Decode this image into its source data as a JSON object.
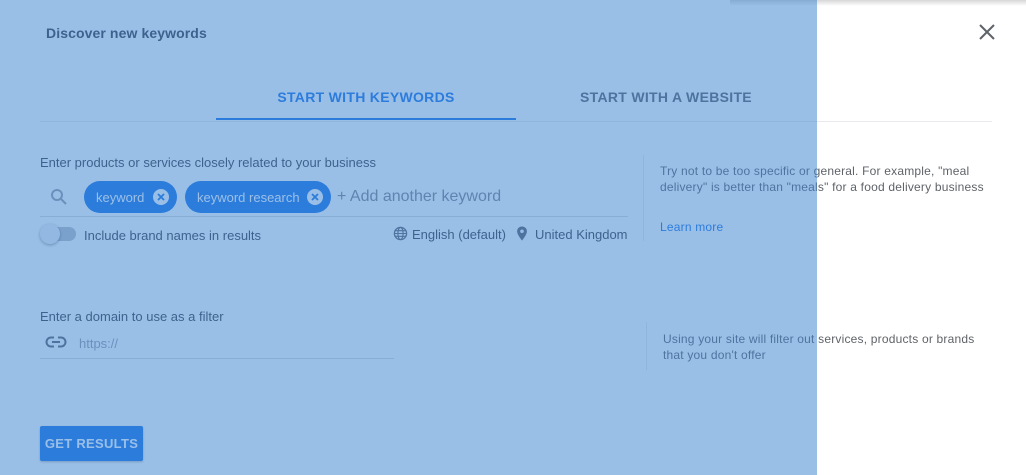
{
  "dialog": {
    "title": "Discover new keywords",
    "close_icon": "close-icon"
  },
  "tabs": [
    {
      "label": "START WITH KEYWORDS",
      "active": true
    },
    {
      "label": "START WITH A WEBSITE",
      "active": false
    }
  ],
  "keywords_section": {
    "label": "Enter products or services closely related to your business",
    "search_icon": "search-icon",
    "chips": [
      {
        "label": "keyword"
      },
      {
        "label": "keyword research"
      }
    ],
    "add_placeholder": "+ Add another keyword",
    "toggle_label": "Include brand names in results",
    "toggle_on": false,
    "language": "English (default)",
    "location": "United Kingdom",
    "tip": "Try not to be too specific or general. For example, \"meal delivery\" is better than \"meals\" for a food delivery business",
    "learn_more": "Learn more"
  },
  "domain_section": {
    "label": "Enter a domain to use as a filter",
    "placeholder": "https://",
    "value": "",
    "tip": "Using your site will filter out services, products or brands that you don't offer"
  },
  "actions": {
    "get_results": "GET RESULTS"
  },
  "colors": {
    "accent": "#1a73e8",
    "overlay": "#3d85d1"
  }
}
